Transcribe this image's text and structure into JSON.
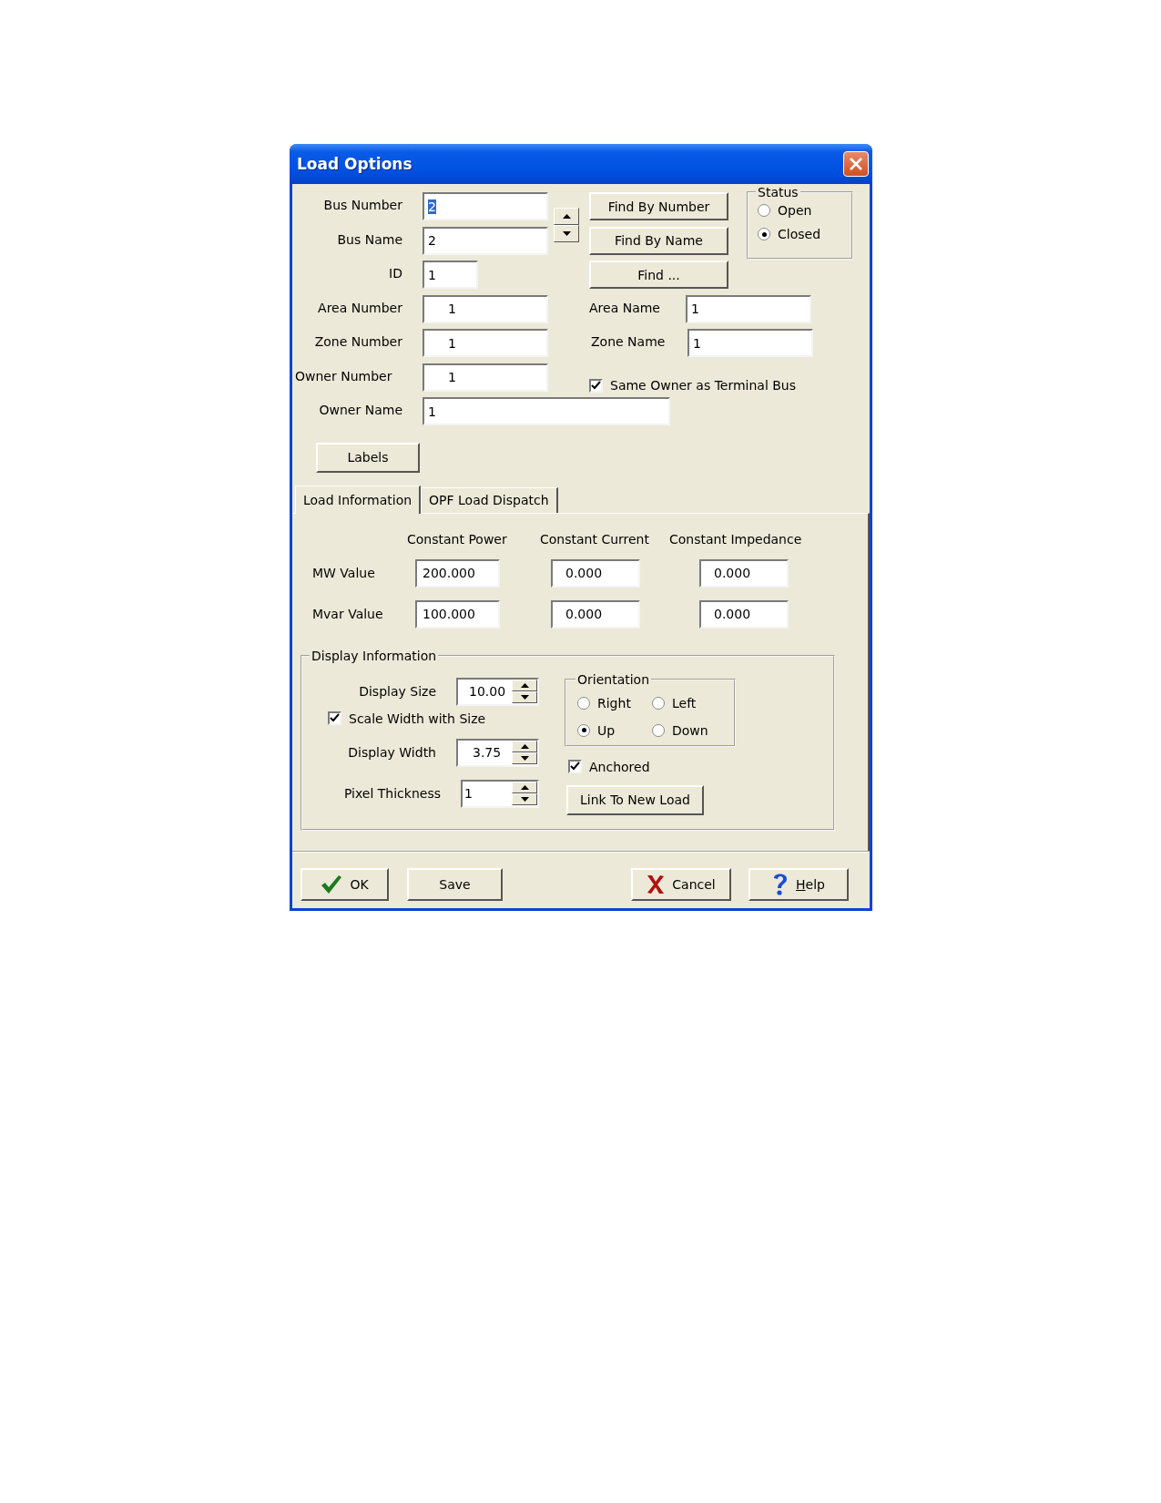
{
  "window": {
    "title": "Load Options"
  },
  "bus_number": {
    "label": "Bus Number",
    "value": "2",
    "highlighted": true
  },
  "bus_name": {
    "label": "Bus Name",
    "value": "2"
  },
  "id": {
    "label": "ID",
    "value": "1"
  },
  "area_number": {
    "label": "Area Number",
    "value": "1"
  },
  "zone_number": {
    "label": "Zone Number",
    "value": "1"
  },
  "owner_number": {
    "label": "Owner Number",
    "value": "1"
  },
  "owner_name": {
    "label": "Owner Name",
    "value": "1"
  },
  "find_buttons": [
    "Find By Number",
    "Find By Name",
    "Find ..."
  ],
  "status": {
    "title": "Status",
    "options": [
      {
        "label": "Open",
        "selected": false
      },
      {
        "label": "Closed",
        "selected": true
      }
    ]
  },
  "area_name": {
    "label": "Area Name",
    "value": "1"
  },
  "zone_name": {
    "label": "Zone Name",
    "value": "1"
  },
  "same_owner": {
    "label": "Same Owner as Terminal Bus",
    "checked": true
  },
  "labels_button": "Labels",
  "tabs": [
    {
      "label": "Load Information",
      "selected": true
    },
    {
      "label": "OPF Load Dispatch",
      "selected": false
    }
  ],
  "load_table": {
    "columns": [
      "Constant Power",
      "Constant Current",
      "Constant Impedance"
    ],
    "rows": [
      {
        "label": "MW Value",
        "values": [
          "200.000",
          "0.000",
          "0.000"
        ]
      },
      {
        "label": "Mvar Value",
        "values": [
          "100.000",
          "0.000",
          "0.000"
        ]
      }
    ]
  },
  "display": {
    "title": "Display Information",
    "display_size": {
      "label": "Display Size",
      "value": "10.00"
    },
    "scale_width": {
      "label": "Scale Width with Size",
      "checked": true
    },
    "display_width": {
      "label": "Display Width",
      "value": "3.75"
    },
    "pixel_thickness": {
      "label": "Pixel Thickness",
      "value": "1"
    },
    "orientation": {
      "title": "Orientation",
      "options": [
        {
          "label": "Right",
          "selected": false
        },
        {
          "label": "Left",
          "selected": false
        },
        {
          "label": "Up",
          "selected": true
        },
        {
          "label": "Down",
          "selected": false
        }
      ]
    },
    "anchored": {
      "label": "Anchored",
      "checked": true
    },
    "link_button": "Link To New Load"
  },
  "buttons": [
    {
      "label": "OK",
      "kind": "ok"
    },
    {
      "label": "Save",
      "kind": "plain"
    },
    {
      "label": "Cancel",
      "kind": "cancel"
    },
    {
      "label": "Help",
      "kind": "help"
    }
  ]
}
